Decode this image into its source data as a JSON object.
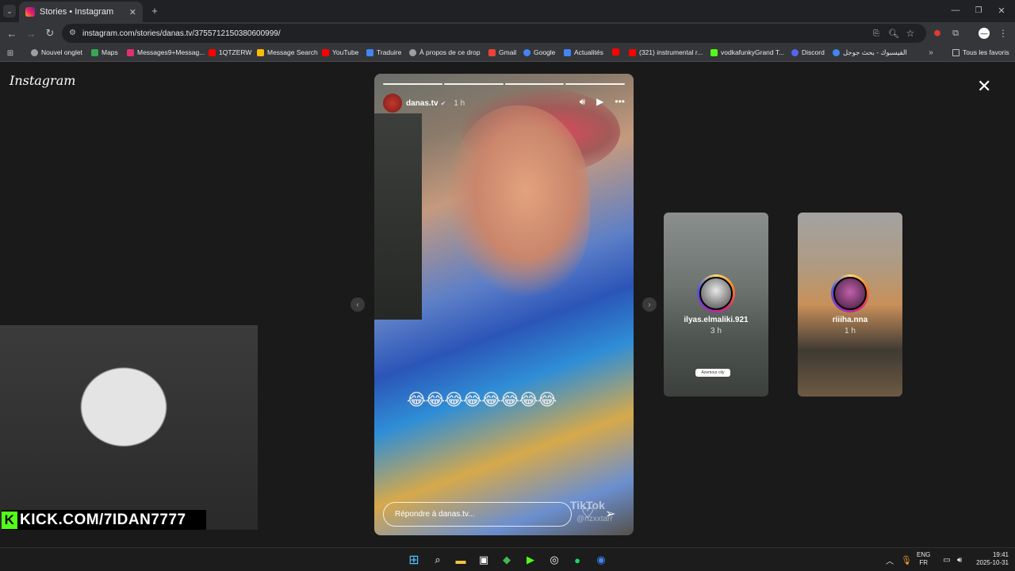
{
  "browser": {
    "tab_title": "Stories • Instagram",
    "url": "instagram.com/stories/danas.tv/3755712150380600999/",
    "bookmarks": [
      {
        "label": "Nouvel onglet",
        "icon": "globe-icon",
        "color": "#9aa0a6"
      },
      {
        "label": "Maps",
        "icon": "maps-icon",
        "color": "#34a853"
      },
      {
        "label": "Messages9+Messag...",
        "icon": "instagram-icon",
        "color": "#e1306c"
      },
      {
        "label": "1QTZERW",
        "icon": "youtube-icon",
        "color": "#ff0000"
      },
      {
        "label": "Message Search",
        "icon": "chart-icon",
        "color": "#fbbc04"
      },
      {
        "label": "YouTube",
        "icon": "youtube-icon",
        "color": "#ff0000"
      },
      {
        "label": "Traduire",
        "icon": "translate-icon",
        "color": "#4285f4"
      },
      {
        "label": "À propos de ce drop",
        "icon": "globe-icon",
        "color": "#9aa0a6"
      },
      {
        "label": "Gmail",
        "icon": "gmail-icon",
        "color": "#ea4335"
      },
      {
        "label": "Google",
        "icon": "google-icon",
        "color": "#4285f4"
      },
      {
        "label": "Actualités",
        "icon": "news-icon",
        "color": "#4285f4"
      },
      {
        "label": "",
        "icon": "youtube-icon",
        "color": "#ff0000"
      },
      {
        "label": "(321) instrumental r...",
        "icon": "youtube-icon",
        "color": "#ff0000"
      },
      {
        "label": "vodkafunkyGrand T...",
        "icon": "kick-icon",
        "color": "#53fc18"
      },
      {
        "label": "Discord",
        "icon": "discord-icon",
        "color": "#5865f2"
      },
      {
        "label": "الفيسبوك - بحث جوجل",
        "icon": "google-icon",
        "color": "#4285f4"
      }
    ],
    "all_bookmarks": "Tous les favoris"
  },
  "instagram": {
    "logo": "Instagram",
    "story": {
      "username": "danas.tv",
      "time": "1 h",
      "progress_count": 4,
      "emojis": "😂😂😂😂😂😂😂😂",
      "reply_placeholder": "Répondre à danas.tv...",
      "watermark": "TikTok",
      "watermark_handle": "@rizxxtarr"
    },
    "next_stories": [
      {
        "username": "ilyas.elmaliki.921",
        "time": "3 h",
        "tag": "Azemour city"
      },
      {
        "username": "riiiha.nna",
        "time": "1 h"
      }
    ]
  },
  "overlay": {
    "kick_text": "KICK.COM/7IDAN7777"
  },
  "taskbar": {
    "lang_top": "ENG",
    "lang_bottom": "FR",
    "time": "19:41",
    "date": "2025-10-31"
  }
}
